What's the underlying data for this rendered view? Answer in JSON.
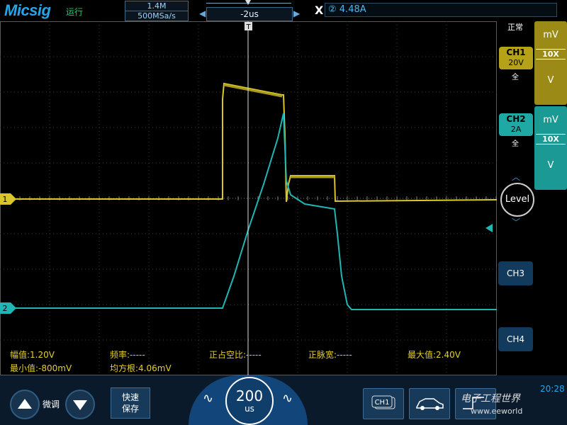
{
  "topbar": {
    "brand": "Micsig",
    "status": "运行",
    "memory_depth": "1.4M",
    "sample_rate": "500MSa/s",
    "time_offset": "-2us",
    "cursor_label": "X",
    "cursor_value": "② 4.48A"
  },
  "right_panel": {
    "acq_mode": "正常",
    "ch1": {
      "label": "CH1",
      "scale": "20V",
      "coupling": "全",
      "unit_top": "mV",
      "probe": "10X",
      "unit_bottom": "V",
      "color": "#b5a219"
    },
    "ch2": {
      "label": "CH2",
      "scale": "2A",
      "coupling": "全",
      "unit_top": "mV",
      "probe": "10X",
      "unit_bottom": "V",
      "color": "#1fa9a5"
    },
    "level_button": "Level",
    "ch3_label": "CH3",
    "ch4_label": "CH4"
  },
  "markers": {
    "ch1": "1",
    "ch2": "2"
  },
  "measurements": {
    "amplitude": "幅值:1.20V",
    "frequency": "频率:-----",
    "duty": "正占空比:-----",
    "pulse_width": "正脉宽:-----",
    "max": "最大值:2.40V",
    "min": "最小值:-800mV",
    "rms": "均方根:4.06mV"
  },
  "bottombar": {
    "fine_label": "微调",
    "quick_save": [
      "快速",
      "保存"
    ],
    "timebase_value": "200",
    "timebase_unit": "us",
    "channel_icon_label": "CH1",
    "clock": "20:28",
    "watermark": "电子工程世界",
    "watermark_url": "www.eeworld"
  },
  "colors": {
    "ch1": "#d9c62a",
    "ch2": "#1fb6b3",
    "grid": "#555555",
    "accent": "#2aa4e8"
  }
}
